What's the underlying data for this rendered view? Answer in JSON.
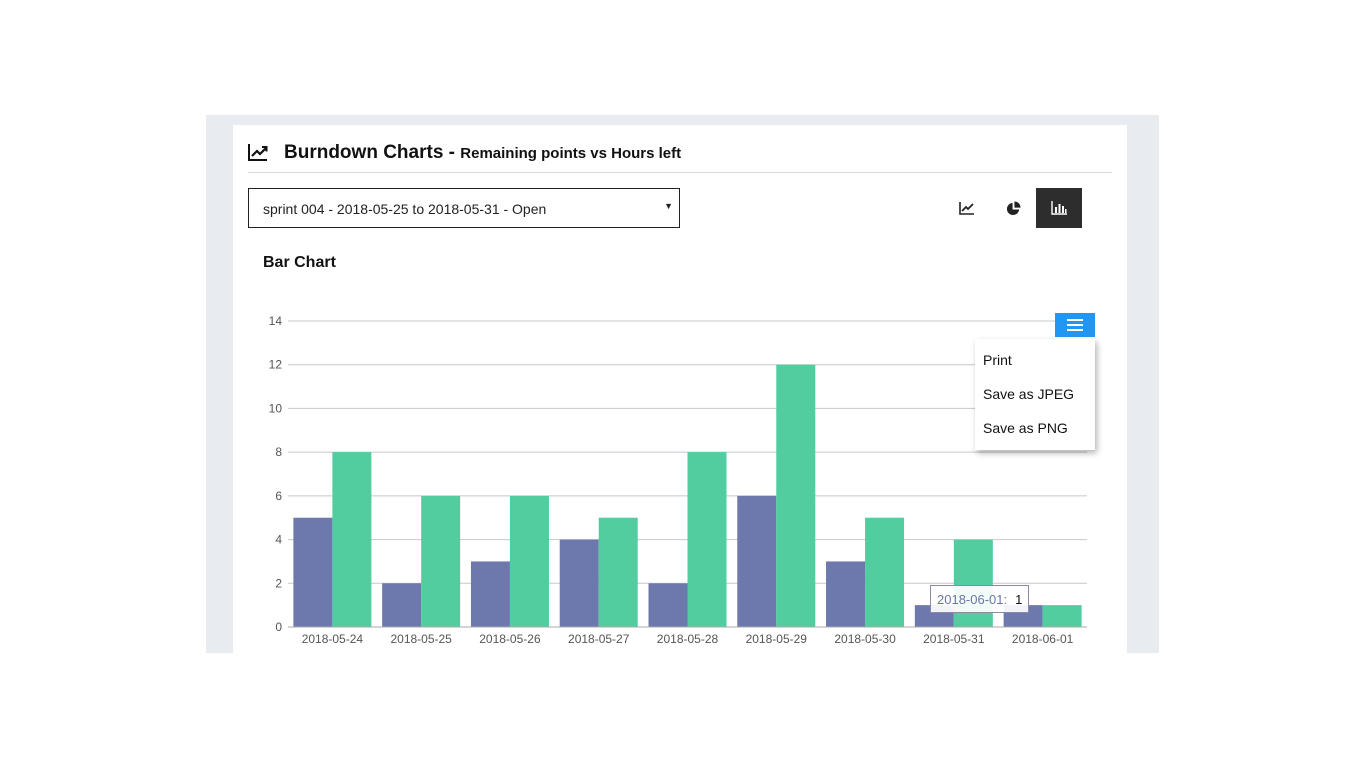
{
  "header": {
    "icon": "trend-line-icon",
    "title": "Burndown Charts - ",
    "subtitle": "Remaining points vs Hours left"
  },
  "sprint_select": {
    "selected": "sprint 004 - 2018-05-25 to 2018-05-31 - Open"
  },
  "view_buttons": [
    {
      "icon": "line-chart-icon",
      "active": false
    },
    {
      "icon": "pie-chart-icon",
      "active": false
    },
    {
      "icon": "bar-chart-icon",
      "active": true
    }
  ],
  "chart_heading": "Bar Chart",
  "export_menu": {
    "icon": "hamburger-menu-icon",
    "items": [
      "Print",
      "Save as JPEG",
      "Save as PNG"
    ]
  },
  "tooltip": {
    "label": "2018-06-01:",
    "value": "1"
  },
  "colors": {
    "series_1": "#6d78ad",
    "series_2": "#51cda0",
    "menu_button": "#2196f3",
    "active_button": "#2d2d2d"
  },
  "chart_data": {
    "type": "bar",
    "title": "Bar Chart",
    "categories": [
      "2018-05-24",
      "2018-05-25",
      "2018-05-26",
      "2018-05-27",
      "2018-05-28",
      "2018-05-29",
      "2018-05-30",
      "2018-05-31",
      "2018-06-01"
    ],
    "series": [
      {
        "values": [
          5,
          2,
          3,
          4,
          2,
          6,
          3,
          1,
          1
        ]
      },
      {
        "values": [
          8,
          6,
          6,
          5,
          8,
          12,
          5,
          4,
          1
        ]
      }
    ],
    "yticks": [
      0,
      2,
      4,
      6,
      8,
      10,
      12,
      14
    ],
    "ylim": [
      0,
      14
    ],
    "grid": true,
    "legend": "none"
  }
}
